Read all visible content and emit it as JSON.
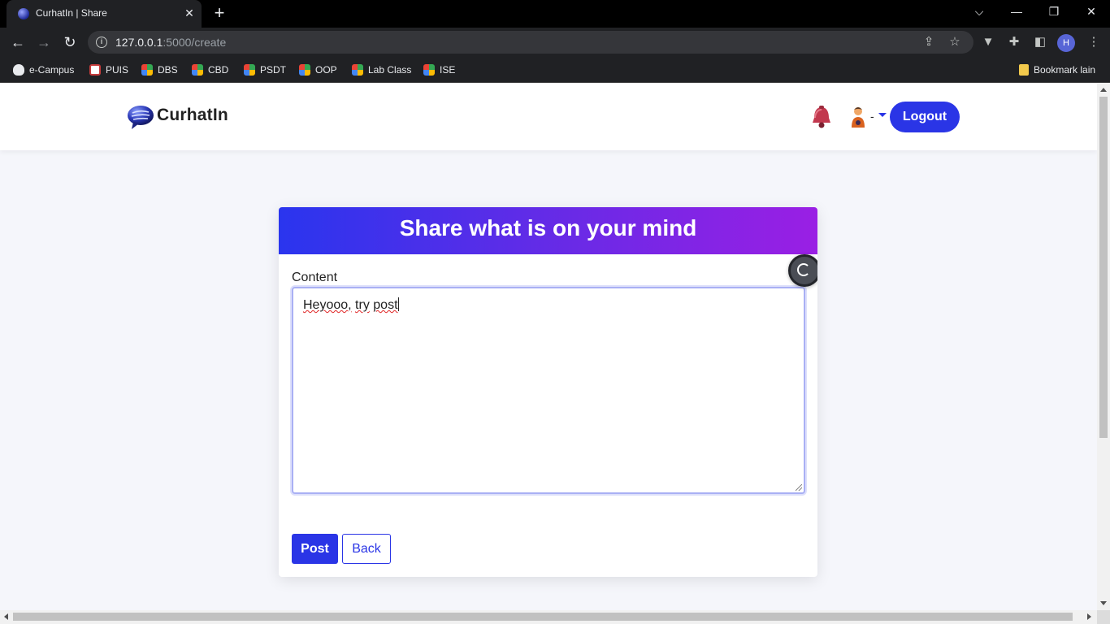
{
  "browser": {
    "tab_title": "CurhatIn | Share",
    "tab_close": "✕",
    "new_tab": "+",
    "window_controls": {
      "tabsearch": "⌵",
      "minimize": "—",
      "restore": "❐",
      "close": "✕"
    },
    "nav": {
      "back": "←",
      "forward": "→",
      "reload": "↻"
    },
    "url_host": "127.0.0.1",
    "url_rest": ":5000/create",
    "profile_initial": "H",
    "bookmarks": [
      {
        "label": "e-Campus",
        "icon": "campus-icon"
      },
      {
        "label": "PUIS",
        "icon": "puis-icon"
      },
      {
        "label": "DBS",
        "icon": "google-classroom-icon"
      },
      {
        "label": "CBD",
        "icon": "google-classroom-icon"
      },
      {
        "label": "PSDT",
        "icon": "google-classroom-icon"
      },
      {
        "label": "OOP",
        "icon": "google-classroom-icon"
      },
      {
        "label": "Lab Class",
        "icon": "google-classroom-icon"
      },
      {
        "label": "ISE",
        "icon": "google-classroom-icon"
      }
    ],
    "other_bookmarks": "Bookmark lain"
  },
  "navbar": {
    "brand": "CurhatIn",
    "user_suffix": "-",
    "logout_label": "Logout"
  },
  "form": {
    "title": "Share what is on your mind",
    "content_label": "Content",
    "content_words": [
      "Heyooo,",
      "try",
      "post"
    ],
    "post_label": "Post",
    "back_label": "Back"
  },
  "colors": {
    "primary": "#2a35e6",
    "header_gradient_start": "#2a35ee",
    "header_gradient_end": "#9a1fe4"
  }
}
